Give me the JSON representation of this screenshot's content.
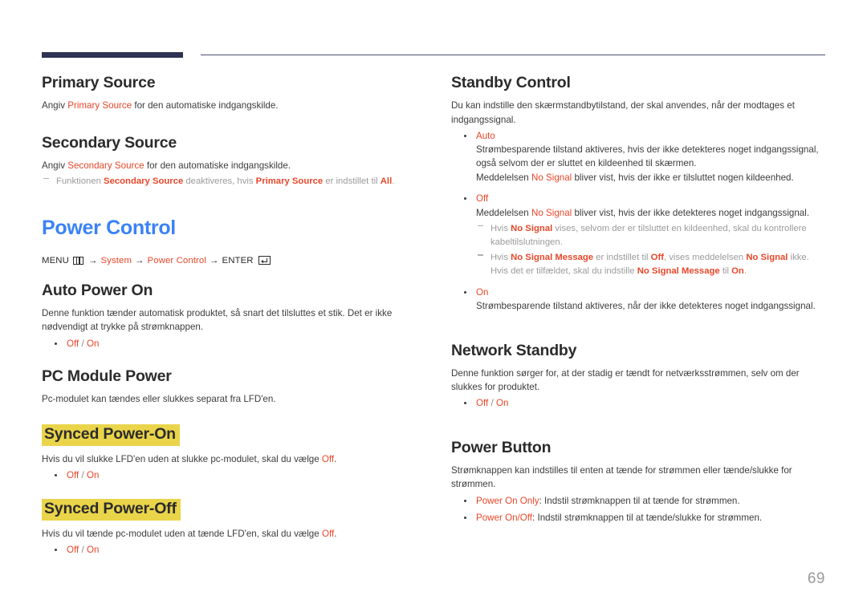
{
  "page": {
    "number": "69",
    "accent_blue": "#3a82f7",
    "accent_red": "#e8472a",
    "highlight_yellow": "#ead44a",
    "rule_navy": "#2d3354"
  },
  "left": {
    "primary_source": {
      "title": "Primary Source",
      "desc_pre": "Angiv ",
      "desc_term": "Primary Source",
      "desc_post": " for den automatiske indgangskilde."
    },
    "secondary_source": {
      "title": "Secondary Source",
      "desc_pre": "Angiv ",
      "desc_term": "Secondary Source",
      "desc_post": " for den automatiske indgangskilde.",
      "note_1": "Funktionen ",
      "note_2": "Secondary Source",
      "note_3": " deaktiveres, hvis ",
      "note_4": "Primary Source",
      "note_5": " er indstillet til ",
      "note_6": "All",
      "note_7": "."
    },
    "power_control": {
      "title": "Power Control",
      "menu_label": "MENU",
      "menu_icon": "menu-grid-icon",
      "path_1": "System",
      "path_2": "Power Control",
      "enter_label": "ENTER",
      "enter_icon": "enter-key-icon",
      "arrow": "→"
    },
    "auto_power_on": {
      "title": "Auto Power On",
      "desc": "Denne funktion tænder automatisk produktet, så snart det tilsluttes et stik. Det er ikke nødvendigt at trykke på strømknappen.",
      "option_off": "Off",
      "option_sep": "/",
      "option_on": "On"
    },
    "pc_module_power": {
      "title": "PC Module Power",
      "desc": "Pc-modulet kan tændes eller slukkes separat fra LFD'en.",
      "synced_on": {
        "title": "Synced Power-On",
        "desc_pre": "Hvis du vil slukke LFD'en uden at slukke pc-modulet, skal du vælge ",
        "desc_term": "Off",
        "desc_post": ".",
        "option_off": "Off",
        "option_sep": "/",
        "option_on": "On"
      },
      "synced_off": {
        "title": "Synced Power-Off",
        "desc_pre": "Hvis du vil tænde pc-modulet uden at tænde LFD'en, skal du vælge ",
        "desc_term": "Off",
        "desc_post": ".",
        "option_off": "Off",
        "option_sep": "/",
        "option_on": "On"
      }
    }
  },
  "right": {
    "standby_control": {
      "title": "Standby Control",
      "desc": "Du kan indstille den skærmstandbytilstand, der skal anvendes, når der modtages et indgangssignal.",
      "auto": {
        "label": "Auto",
        "line_1": "Strømbesparende tilstand aktiveres, hvis der ikke detekteres noget indgangssignal, også selvom der er sluttet en kildeenhed til skærmen.",
        "line_2_pre": "Meddelelsen ",
        "line_2_term": "No Signal",
        "line_2_post": " bliver vist, hvis der ikke er tilsluttet nogen kildeenhed."
      },
      "off": {
        "label": "Off",
        "line_1_pre": "Meddelelsen ",
        "line_1_term": "No Signal",
        "line_1_post": " bliver vist, hvis der ikke detekteres noget indgangssignal.",
        "note_a_1": "Hvis ",
        "note_a_2": "No Signal",
        "note_a_3": " vises, selvom der er tilsluttet en kildeenhed, skal du kontrollere kabeltilslutningen.",
        "note_b_1": "Hvis ",
        "note_b_2": "No Signal Message",
        "note_b_3": " er indstillet til ",
        "note_b_4": "Off",
        "note_b_5": ", vises meddelelsen ",
        "note_b_6": "No Signal",
        "note_b_7": " ikke.",
        "note_b_8": "Hvis det er tilfældet, skal du indstille ",
        "note_b_9": "No Signal Message",
        "note_b_10": " til ",
        "note_b_11": "On",
        "note_b_12": "."
      },
      "on": {
        "label": "On",
        "line_1": "Strømbesparende tilstand aktiveres, når der ikke detekteres noget indgangssignal."
      }
    },
    "network_standby": {
      "title": "Network Standby",
      "desc": "Denne funktion sørger for, at der stadig er tændt for netværksstrømmen, selv om der slukkes for produktet.",
      "option_off": "Off",
      "option_sep": "/",
      "option_on": "On"
    },
    "power_button": {
      "title": "Power Button",
      "desc": "Strømknappen kan indstilles til enten at tænde for strømmen eller tænde/slukke for strømmen.",
      "opt1_term": "Power On Only",
      "opt1_text": ": Indstil strømknappen til at tænde for strømmen.",
      "opt2_term": "Power On/Off",
      "opt2_text": ": Indstil strømknappen til at tænde/slukke for strømmen."
    }
  }
}
